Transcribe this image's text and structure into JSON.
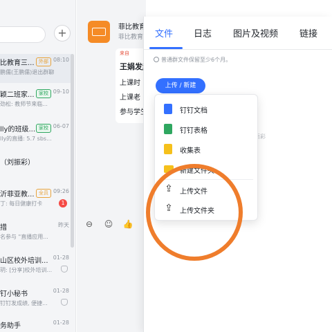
{
  "sidebar": {
    "plus": "+",
    "conversations": [
      {
        "title": "比教育三...",
        "tag": "外部",
        "tag_color": "orange",
        "time": "08:10",
        "snippet": "鹏儒(王鹏儒)退出群聊",
        "badge": "",
        "selected": true
      },
      {
        "title": "颖二班家...",
        "tag": "家校",
        "tag_color": "green",
        "time": "09-10",
        "snippet": "劲松: 教师节来临...",
        "badge": "",
        "selected": false
      },
      {
        "title": "lly的班级...",
        "tag": "家校",
        "tag_color": "green",
        "time": "06-07",
        "snippet": "lly的直播: 5.7 sbs...",
        "badge": "",
        "selected": false
      },
      {
        "title": "（刘振彩）",
        "tag": "",
        "tag_color": "",
        "time": "",
        "snippet": "",
        "badge": "",
        "selected": false
      },
      {
        "title": "沂菲亚教...",
        "tag": "全员",
        "tag_color": "orange",
        "time": "09:26",
        "snippet": "丁: 每日健康打卡",
        "badge": "1",
        "selected": false
      },
      {
        "title": "措",
        "tag": "",
        "tag_color": "",
        "time": "昨天",
        "snippet": "名参与 \"直播应用...",
        "badge": "",
        "selected": false
      },
      {
        "title": "山区校外培训...",
        "tag": "",
        "tag_color": "",
        "time": "01-28",
        "snippet": "玥: [分享]校外培训...",
        "badge": "",
        "selected": false,
        "muted": true
      },
      {
        "title": "钉小秘书",
        "tag": "",
        "tag_color": "",
        "time": "01-28",
        "snippet": "钉钉发成绩, 便捷...",
        "badge": "",
        "selected": false,
        "muted": true
      },
      {
        "title": "务助手",
        "tag": "",
        "tag_color": "",
        "time": "01-28",
        "snippet": "",
        "badge": "",
        "selected": false
      }
    ]
  },
  "chat": {
    "group_name": "菲比教育",
    "group_sub": "菲比教育",
    "card_from": "来自",
    "card_lines": [
      "王娟发起",
      "上课时",
      "上课老",
      "参与学生"
    ],
    "actions": [
      "reply-icon",
      "emoji-icon",
      "like-icon"
    ]
  },
  "panel": {
    "tabs": [
      "文件",
      "日志",
      "图片及视频",
      "链接"
    ],
    "active_tab": 0,
    "note": "普通群文件保留至少6个月。",
    "upload_button": "上传 / 新建",
    "faint_text": "振彩"
  },
  "menu": {
    "items": [
      {
        "label": "钉钉文档",
        "icon": "doc-icon"
      },
      {
        "label": "钉钉表格",
        "icon": "sheet-icon"
      },
      {
        "label": "收集表",
        "icon": "form-icon"
      },
      {
        "label": "新建文件夹",
        "icon": "folder-icon"
      },
      {
        "label": "上传文件",
        "icon": "upload-file-icon"
      },
      {
        "label": "上传文件夹",
        "icon": "upload-folder-icon"
      }
    ]
  },
  "colors": {
    "accent": "#3370ff",
    "annotation": "#ef7d2c",
    "badge": "#f54a45",
    "group_avatar": "#f58b26"
  }
}
